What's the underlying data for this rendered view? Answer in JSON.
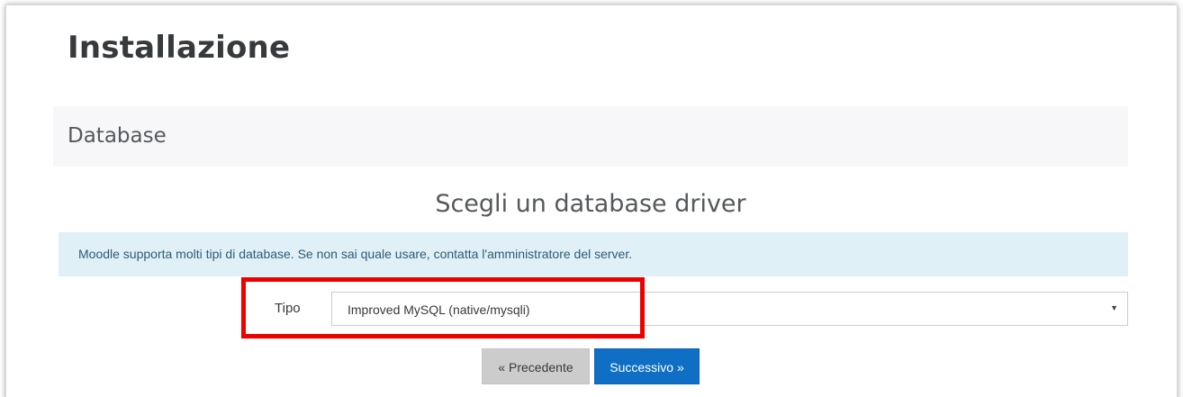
{
  "page": {
    "title": "Installazione"
  },
  "section": {
    "label": "Database"
  },
  "driver": {
    "heading": "Scegli un database driver",
    "info": "Moodle supporta molti tipi di database. Se non sai quale usare, contatta l'amministratore del server.",
    "field_label": "Tipo",
    "selected_value": "Improved MySQL (native/mysqli)",
    "dropdown_icon": "chevron-down-icon"
  },
  "buttons": {
    "previous_label": "« Precedente",
    "next_label": "Successivo »"
  },
  "colors": {
    "primary": "#0f6fc5",
    "alert_bg": "#e0f0f7",
    "highlight": "#ee0000"
  }
}
